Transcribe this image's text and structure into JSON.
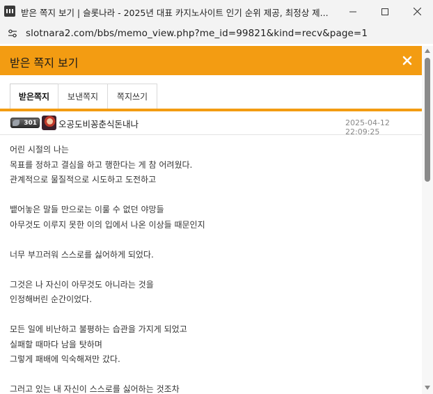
{
  "window": {
    "title": "받은 쪽지 보기 | 슬롯나라 - 2025년 대표 카지노사이트 인기 순위 제공, 최정상 제...",
    "app_icon": "window-app-icon",
    "controls": [
      "minimize-icon",
      "maximize-icon",
      "close-icon"
    ]
  },
  "address_bar": {
    "url": "slotnara2.com/bbs/memo_view.php?me_id=99821&kind=recv&page=1",
    "site_info_icon": "tune-icon"
  },
  "header": {
    "title": "받은 쪽지 보기",
    "close_icon": "close-icon",
    "color": "#f39c12"
  },
  "tabs": [
    {
      "label": "받은쪽지",
      "active": true
    },
    {
      "label": "보낸쪽지",
      "active": false
    },
    {
      "label": "쪽지쓰기",
      "active": false
    }
  ],
  "message": {
    "level": "301",
    "sender": "오공도비꽁춘식돈내나",
    "date": "2025-04-12 22:09:25",
    "lines": [
      "어린 시절의 나는",
      "목표를 정하고 결심을 하고 행한다는 게 참 어려웠다.",
      "관계적으로 물질적으로 시도하고 도전하고",
      "",
      "뱉어놓은 말들 만으로는 이룰 수 없던 야망들",
      "아무것도 이루지 못한 이의 입에서 나온 이상들 때문인지",
      "",
      "너무 부끄러워 스스로를 싫어하게 되었다.",
      "",
      "그것은 나 자신이 아무것도 아니라는 것을",
      "인정해버린 순간이었다.",
      "",
      "모든 일에 비난하고 불평하는 습관을 가지게 되었고",
      "실패할 때마다 남을 탓하며",
      "그렇게 패배에 익숙해져만 갔다.",
      "",
      "그러고 있는 내 자신이 스스로를 싫어하는 것조차"
    ]
  }
}
